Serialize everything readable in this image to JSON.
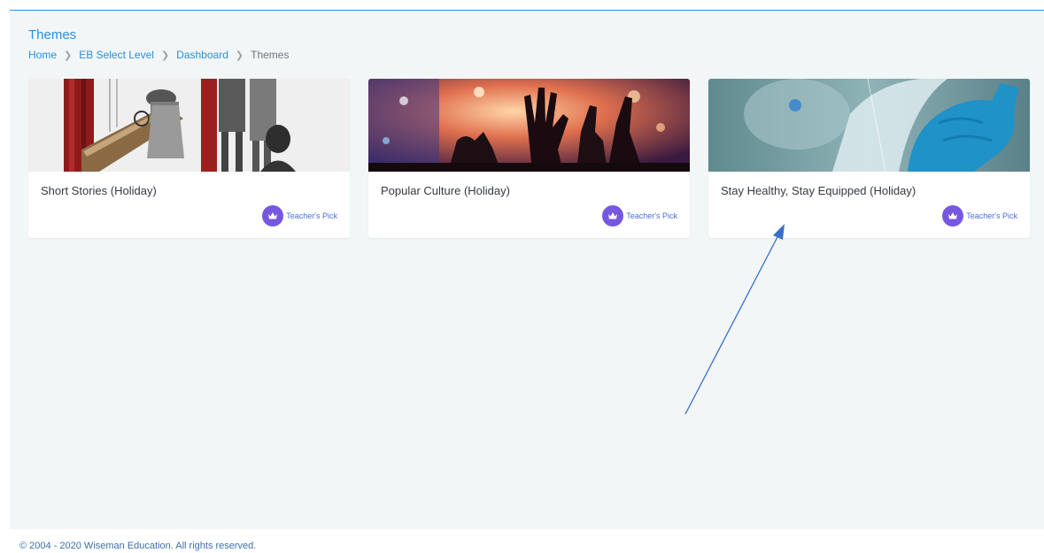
{
  "header": {
    "title": "Themes"
  },
  "breadcrumb": {
    "items": [
      "Home",
      "EB Select Level",
      "Dashboard"
    ],
    "current": "Themes"
  },
  "cards": [
    {
      "title": "Short Stories (Holiday)",
      "badge": "Teacher's Pick",
      "image": "detective-sketch-illustration"
    },
    {
      "title": "Popular Culture (Holiday)",
      "badge": "Teacher's Pick",
      "image": "concert-crowd-photo"
    },
    {
      "title": "Stay Healthy, Stay Equipped (Holiday)",
      "badge": "Teacher's Pick",
      "image": "protective-equipment-photo"
    }
  ],
  "footer": {
    "copyright": "© 2004 - 2020 Wiseman Education. All rights reserved."
  },
  "colors": {
    "accent": "#2b8fdc",
    "badge": "#7657e0",
    "background": "#f2f6f7",
    "annotation": "#3a6ec8"
  }
}
